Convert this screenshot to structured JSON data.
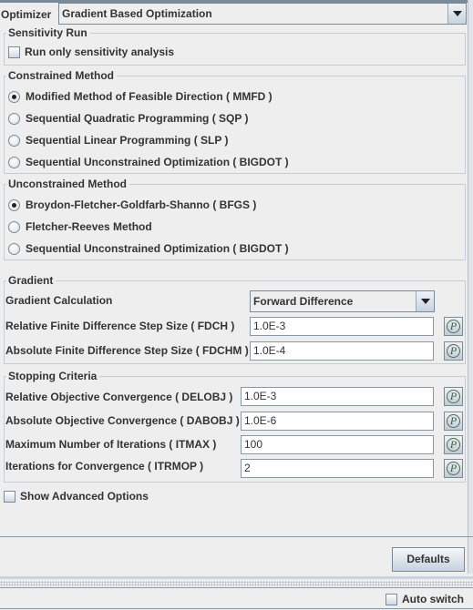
{
  "optimizer": {
    "label": "Optimizer",
    "selected": "Gradient Based Optimization"
  },
  "sensitivity": {
    "title": "Sensitivity Run",
    "checkbox_label": "Run only sensitivity analysis",
    "checked": false
  },
  "constrained": {
    "title": "Constrained Method",
    "options": [
      {
        "label": "Modified Method of Feasible Direction ( MMFD )",
        "selected": true
      },
      {
        "label": "Sequential Quadratic Programming ( SQP )",
        "selected": false
      },
      {
        "label": "Sequential Linear Programming ( SLP )",
        "selected": false
      },
      {
        "label": "Sequential Unconstrained Optimization ( BIGDOT )",
        "selected": false
      }
    ]
  },
  "unconstrained": {
    "title": "Unconstrained Method",
    "options": [
      {
        "label": "Broydon-Fletcher-Goldfarb-Shanno ( BFGS )",
        "selected": true
      },
      {
        "label": "Fletcher-Reeves Method",
        "selected": false
      },
      {
        "label": "Sequential Unconstrained Optimization ( BIGDOT )",
        "selected": false
      }
    ]
  },
  "gradient": {
    "title": "Gradient",
    "calculation_label": "Gradient Calculation",
    "calculation_value": "Forward Difference",
    "fields": [
      {
        "label": "Relative Finite Difference Step Size ( FDCH )",
        "value": "1.0E-3"
      },
      {
        "label": "Absolute Finite Difference Step Size ( FDCHM )",
        "value": "1.0E-4"
      }
    ]
  },
  "stopping": {
    "title": "Stopping Criteria",
    "fields": [
      {
        "label": "Relative Objective Convergence ( DELOBJ )",
        "value": "1.0E-3"
      },
      {
        "label": "Absolute Objective Convergence ( DABOBJ )",
        "value": "1.0E-6"
      },
      {
        "label": "Maximum Number of Iterations ( ITMAX )",
        "value": "100"
      },
      {
        "label": "Iterations for Convergence ( ITRMOP )",
        "value": "2"
      }
    ]
  },
  "advanced": {
    "label": "Show Advanced Options",
    "checked": false
  },
  "param_button_glyph": "P",
  "defaults_label": "Defaults",
  "auto_switch": {
    "label": "Auto switch",
    "checked": false
  }
}
